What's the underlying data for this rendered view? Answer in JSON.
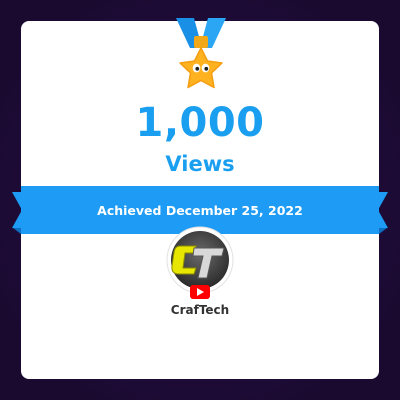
{
  "achievement": {
    "count": "1,000",
    "unit": "Views",
    "achieved_text": "Achieved December 25, 2022"
  },
  "channel": {
    "name": "CrafTech",
    "platform_icon": "youtube-icon",
    "avatar_icon": "craftech-logo-icon"
  },
  "colors": {
    "accent": "#1a9ff0",
    "ribbon": "#1e9bf5",
    "ribbon_dark": "#0b6fc2",
    "background": "#1d0b36",
    "card": "#ffffff",
    "star": "#ffb21f",
    "youtube": "#ff0000"
  }
}
